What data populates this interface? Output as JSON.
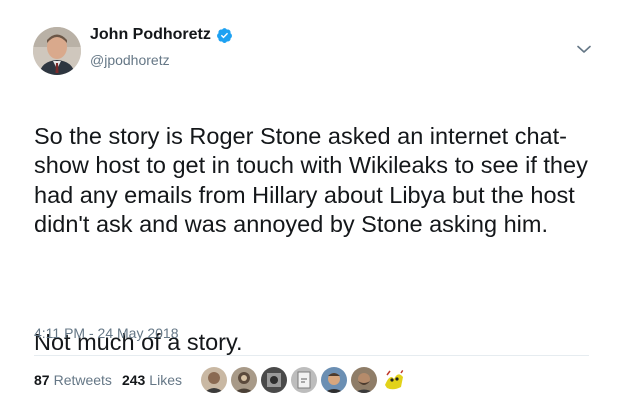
{
  "author": {
    "display_name": "John Podhoretz",
    "handle": "@jpodhoretz",
    "verified": true
  },
  "tweet": {
    "paragraphs": [
      "So the story is Roger Stone asked an internet chat-show host to get in touch with Wikileaks to see if they had any emails from Hillary about Libya but the host didn't ask and was annoyed by Stone asking him.",
      "Not much of a story."
    ],
    "timestamp": "4:11 PM - 24 May 2018"
  },
  "stats": {
    "retweets_count": "87",
    "retweets_label": "Retweets",
    "likes_count": "243",
    "likes_label": "Likes"
  },
  "likers": [
    {
      "avatar": "liker-1",
      "color": "#8a6a52"
    },
    {
      "avatar": "liker-2",
      "color": "#5b4a3c"
    },
    {
      "avatar": "liker-3",
      "color": "#3d3d3d"
    },
    {
      "avatar": "liker-4",
      "color": "#7c7c7c"
    },
    {
      "avatar": "liker-5",
      "color": "#4a3b2f"
    },
    {
      "avatar": "liker-6",
      "color": "#6e5a44"
    },
    {
      "avatar": "liker-7",
      "color": "#e2d21a"
    }
  ],
  "colors": {
    "text": "#14171a",
    "secondary": "#657786",
    "verified": "#1da1f2",
    "divider": "#e6ecf0"
  },
  "icons": {
    "verified": "verified-badge-icon",
    "caret": "chevron-down-icon"
  }
}
